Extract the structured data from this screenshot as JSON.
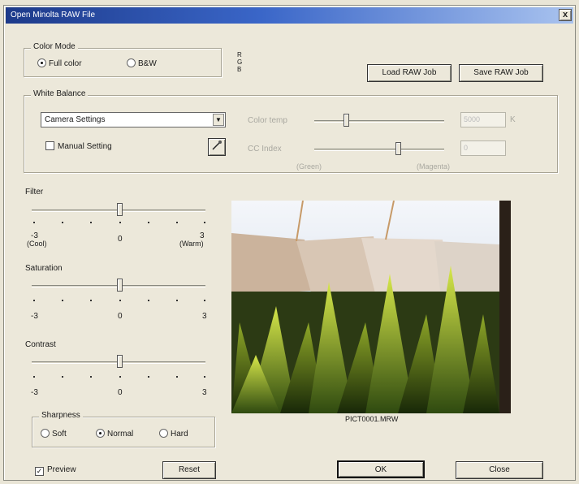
{
  "window": {
    "title": "Open Minolta RAW File",
    "close_glyph": "x"
  },
  "color_mode": {
    "label": "Color Mode",
    "options": [
      {
        "label": "Full color",
        "selected": true
      },
      {
        "label": "B&W",
        "selected": false
      }
    ],
    "rgb_letters": [
      "R",
      "G",
      "B"
    ]
  },
  "buttons": {
    "load_raw_job": "Load RAW Job",
    "save_raw_job": "Save RAW Job",
    "reset": "Reset",
    "ok": "OK",
    "close": "Close"
  },
  "white_balance": {
    "label": "White Balance",
    "select_value": "Camera Settings",
    "manual_setting_label": "Manual Setting",
    "manual_setting_checked": false,
    "color_temp_label": "Color temp",
    "color_temp_value": "5000",
    "color_temp_unit": "K",
    "cc_index_label": "CC Index",
    "cc_index_value": "0",
    "cc_left_label": "(Green)",
    "cc_right_label": "(Magenta)"
  },
  "filter": {
    "label": "Filter",
    "min_label": "-3",
    "min_sub": "(Cool)",
    "mid_label": "0",
    "max_label": "3",
    "max_sub": "(Warm)",
    "value": 0
  },
  "saturation": {
    "label": "Saturation",
    "min_label": "-3",
    "mid_label": "0",
    "max_label": "3",
    "value": 0
  },
  "contrast": {
    "label": "Contrast",
    "min_label": "-3",
    "mid_label": "0",
    "max_label": "3",
    "value": 0
  },
  "sharpness": {
    "label": "Sharpness",
    "options": [
      {
        "label": "Soft",
        "selected": false
      },
      {
        "label": "Normal",
        "selected": true
      },
      {
        "label": "Hard",
        "selected": false
      }
    ]
  },
  "preview": {
    "label": "Preview",
    "checked": true,
    "filename": "PICT0001.MRW"
  },
  "colors": {
    "title_start": "#1d3a8a",
    "title_end": "#a9c3ef",
    "dialog_bg": "#ece8da"
  },
  "icons": {
    "close": "close-icon",
    "eyedropper": "eyedropper-icon",
    "dropdown": "chevron-down-icon"
  }
}
